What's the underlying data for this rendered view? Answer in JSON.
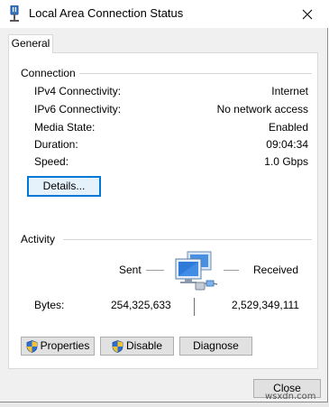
{
  "window": {
    "title": "Local Area Connection Status"
  },
  "tabs": [
    {
      "label": "General"
    }
  ],
  "connection": {
    "heading": "Connection",
    "rows": [
      {
        "label": "IPv4 Connectivity:",
        "value": "Internet"
      },
      {
        "label": "IPv6 Connectivity:",
        "value": "No network access"
      },
      {
        "label": "Media State:",
        "value": "Enabled"
      },
      {
        "label": "Duration:",
        "value": "09:04:34"
      },
      {
        "label": "Speed:",
        "value": "1.0 Gbps"
      }
    ],
    "details_label": "Details..."
  },
  "activity": {
    "heading": "Activity",
    "sent_label": "Sent",
    "received_label": "Received",
    "bytes_label": "Bytes:",
    "bytes_sent": "254,325,633",
    "bytes_received": "2,529,349,111"
  },
  "buttons": {
    "properties": "Properties",
    "disable": "Disable",
    "diagnose": "Diagnose",
    "close": "Close"
  },
  "watermark": "wsxdn.com",
  "colors": {
    "accent": "#0078d7",
    "shield_blue": "#2f6fd1",
    "shield_yellow": "#f2c230"
  },
  "icons": {
    "title": "network-adapter-icon",
    "close": "close-icon",
    "network": "network-computers-icon",
    "shield": "uac-shield-icon"
  }
}
